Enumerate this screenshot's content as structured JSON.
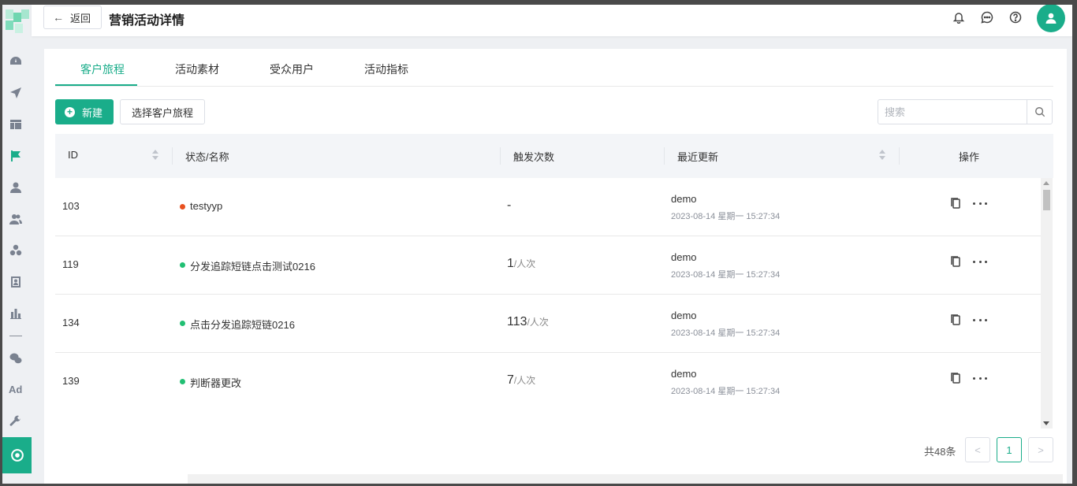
{
  "header": {
    "back_label": "返回",
    "title": "营销活动详情",
    "icons": [
      "bell-icon",
      "chat-icon",
      "help-icon",
      "user-avatar-icon"
    ]
  },
  "sidebar": {
    "items": [
      "dashboard-icon",
      "send-icon",
      "layout-icon",
      "flag-icon",
      "user-icon",
      "users-icon",
      "segments-icon",
      "contact-card-icon",
      "bar-chart-icon",
      "wechat-icon",
      "ad-icon",
      "wrench-icon",
      "marketing-icon"
    ],
    "ad_label": "Ad",
    "active_item": "marketing-icon"
  },
  "tabs": [
    {
      "label": "客户旅程",
      "active": true
    },
    {
      "label": "活动素材",
      "active": false
    },
    {
      "label": "受众用户",
      "active": false
    },
    {
      "label": "活动指标",
      "active": false
    }
  ],
  "toolbar": {
    "new_label": "新建",
    "select_label": "选择客户旅程",
    "search_placeholder": "搜索"
  },
  "table": {
    "columns": [
      "ID",
      "状态/名称",
      "触发次数",
      "最近更新",
      "操作"
    ],
    "rows": [
      {
        "id": "103",
        "status_color": "#e8501f",
        "name": "testyyp",
        "trigger_count": "-",
        "trigger_unit": "",
        "user": "demo",
        "updated": "2023-08-14 星期一 15:27:34"
      },
      {
        "id": "119",
        "status_color": "#21bf73",
        "name": "分发追踪短链点击测试0216",
        "trigger_count": "1",
        "trigger_unit": "/人次",
        "user": "demo",
        "updated": "2023-08-14 星期一 15:27:34"
      },
      {
        "id": "134",
        "status_color": "#21bf73",
        "name": "点击分发追踪短链0216",
        "trigger_count": "113",
        "trigger_unit": "/人次",
        "user": "demo",
        "updated": "2023-08-14 星期一 15:27:34"
      },
      {
        "id": "139",
        "status_color": "#21bf73",
        "name": "判断器更改",
        "trigger_count": "7",
        "trigger_unit": "/人次",
        "user": "demo",
        "updated": "2023-08-14 星期一 15:27:34"
      }
    ]
  },
  "pagination": {
    "total_label": "共48条",
    "prev": "<",
    "current": "1",
    "next": ">"
  },
  "colors": {
    "accent": "#1aad8a",
    "status_error": "#e8501f",
    "status_ok": "#21bf73"
  }
}
